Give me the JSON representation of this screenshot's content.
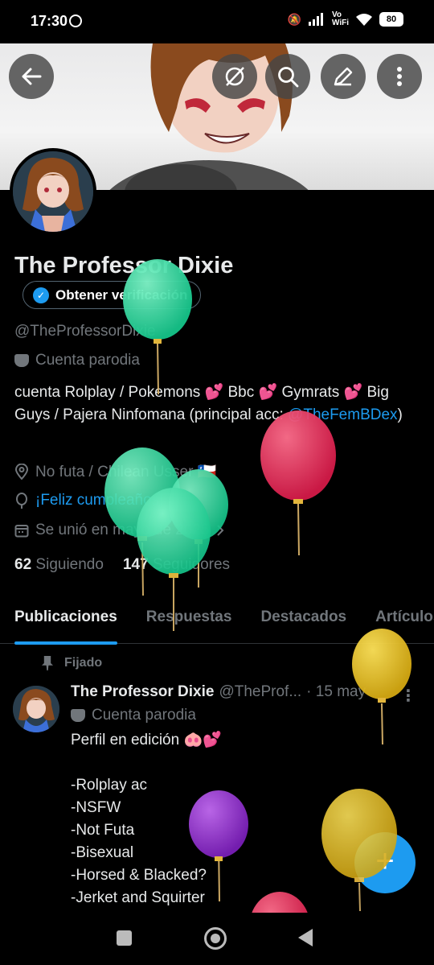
{
  "status_bar": {
    "time": "17:30",
    "volte_line1": "Vo",
    "volte_line2": "WiFi",
    "battery": "80"
  },
  "profile": {
    "name": "The Professor Dixie",
    "verify_label": "Obtener verificación",
    "handle": "@TheProfessorDixie",
    "parody_label": "Cuenta parodia",
    "bio_text": "cuenta Rolplay / Pokemons 💕 Bbc 💕 Gymrats 💕 Big Guys / Pajera Ninfomana (principal acc: ",
    "bio_link": "@TheFemBDex",
    "bio_end": ")",
    "location": "No futa / Chilean Usser 🇨🇱",
    "birthday": "¡Feliz cumpleaños!",
    "joined": "Se unió en mayo de 2025",
    "following_count": "62",
    "following_label": "Siguiendo",
    "followers_count": "147",
    "followers_label": "Seguidores"
  },
  "tabs": [
    "Publicaciones",
    "Respuestas",
    "Destacados",
    "Artículos"
  ],
  "pinned_label": "Fijado",
  "post": {
    "name": "The Professor Dixie",
    "handle": "@TheProf...",
    "date": "· 15 may",
    "parody_label": "Cuenta parodia",
    "body": "Perfil en edición 🐽💕\n\n-Rolplay ac\n-NSFW\n-Not Futa\n-Bisexual\n-Horsed & Blacked?\n-Jerket and Squirter"
  },
  "fab_label": "+",
  "colors": {
    "accent": "#1d9bf0",
    "background": "#000000",
    "muted": "#71767b"
  }
}
